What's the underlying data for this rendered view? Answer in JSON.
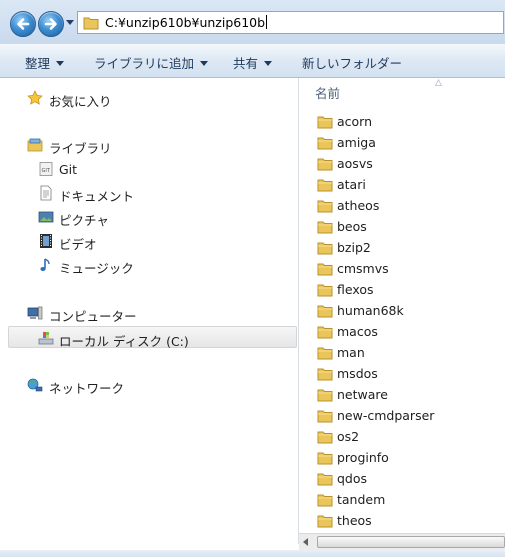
{
  "address": {
    "path": "C:¥unzip610b¥unzip610b"
  },
  "toolbar": {
    "organize": "整理",
    "include_in_library": "ライブラリに追加",
    "share": "共有",
    "new_folder": "新しいフォルダー"
  },
  "nav": {
    "favorites": "お気に入り",
    "libraries": "ライブラリ",
    "git": "Git",
    "documents": "ドキュメント",
    "pictures": "ピクチャ",
    "videos": "ビデオ",
    "music": "ミュージック",
    "computer": "コンピューター",
    "local_disk": "ローカル ディスク (C:)",
    "network": "ネットワーク"
  },
  "content": {
    "column_name": "名前",
    "files": [
      "acorn",
      "amiga",
      "aosvs",
      "atari",
      "atheos",
      "beos",
      "bzip2",
      "cmsmvs",
      "flexos",
      "human68k",
      "macos",
      "man",
      "msdos",
      "netware",
      "new-cmdparser",
      "os2",
      "proginfo",
      "qdos",
      "tandem",
      "theos"
    ]
  },
  "colors": {
    "folder": "#e9c55a",
    "accent": "#1e395b"
  }
}
